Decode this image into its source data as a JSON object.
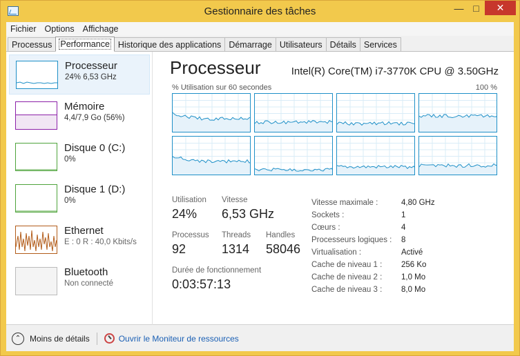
{
  "window": {
    "title": "Gestionnaire des tâches"
  },
  "menu": [
    "Fichier",
    "Options",
    "Affichage"
  ],
  "tabs": [
    "Processus",
    "Performance",
    "Historique des applications",
    "Démarrage",
    "Utilisateurs",
    "Détails",
    "Services"
  ],
  "active_tab": "Performance",
  "sidebar": [
    {
      "name": "Processeur",
      "sub": "24% 6,53 GHz",
      "color": "#1d8fc7"
    },
    {
      "name": "Mémoire",
      "sub": "4,4/7,9 Go (56%)",
      "color": "#8b1fa8"
    },
    {
      "name": "Disque 0 (C:)",
      "sub": "0%",
      "color": "#4da33a"
    },
    {
      "name": "Disque 1 (D:)",
      "sub": "0%",
      "color": "#4da33a"
    },
    {
      "name": "Ethernet",
      "sub": "E : 0 R : 40,0 Kbits/s",
      "color": "#b25b18"
    },
    {
      "name": "Bluetooth",
      "sub": "Non connecté",
      "color": "#888888"
    }
  ],
  "detail": {
    "title": "Processeur",
    "model": "Intel(R) Core(TM) i7-3770K CPU @ 3.50GHz",
    "util_label": "% Utilisation sur 60 secondes",
    "util_max": "100 %",
    "stats": {
      "utilisation_label": "Utilisation",
      "utilisation": "24%",
      "vitesse_label": "Vitesse",
      "vitesse": "6,53 GHz",
      "processus_label": "Processus",
      "processus": "92",
      "threads_label": "Threads",
      "threads": "1314",
      "handles_label": "Handles",
      "handles": "58046",
      "uptime_label": "Durée de fonctionnement",
      "uptime": "0:03:57:13"
    },
    "specs": [
      {
        "key": "Vitesse maximale :",
        "value": "4,80 GHz"
      },
      {
        "key": "Sockets :",
        "value": "1"
      },
      {
        "key": "Cœurs :",
        "value": "4"
      },
      {
        "key": "Processeurs logiques :",
        "value": "8"
      },
      {
        "key": "Virtualisation :",
        "value": "Activé"
      },
      {
        "key": "Cache de niveau 1 :",
        "value": "256 Ko"
      },
      {
        "key": "Cache de niveau 2 :",
        "value": "1,0 Mo"
      },
      {
        "key": "Cache de niveau 3 :",
        "value": "8,0 Mo"
      }
    ]
  },
  "footer": {
    "less_details": "Moins de détails",
    "resource_monitor": "Ouvrir le Moniteur de ressources"
  },
  "colors": {
    "graph_line": "#1d8fc7",
    "graph_fill": "#e6f2fa",
    "titlebar": "#f2c94c",
    "close": "#c7372c"
  }
}
